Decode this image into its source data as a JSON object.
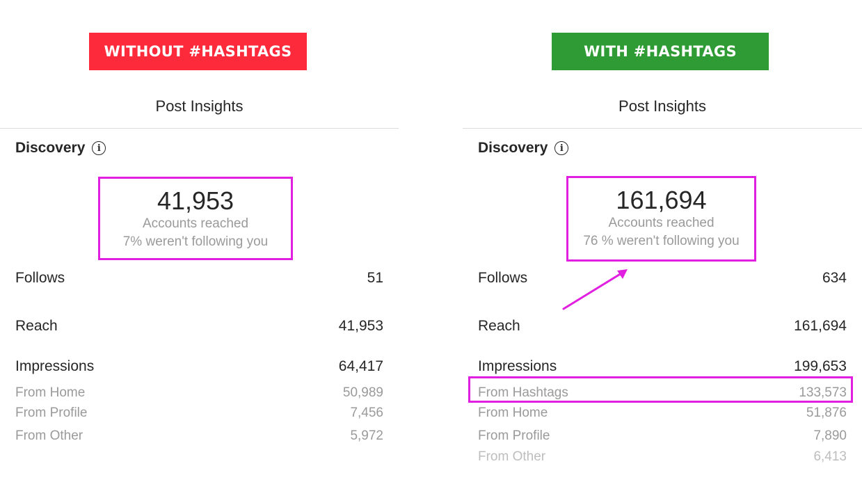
{
  "colors": {
    "without_banner": "#fc2a3b",
    "with_banner": "#2f9b35",
    "highlight": "#e11fe0"
  },
  "without": {
    "banner": "WITHOUT #HASHTAGS",
    "title": "Post Insights",
    "section": "Discovery",
    "accounts_reached_value": "41,953",
    "accounts_reached_label": "Accounts reached",
    "not_following": "7% weren't following you",
    "metrics": [
      {
        "label": "Follows",
        "value": "51"
      },
      {
        "label": "Reach",
        "value": "41,953"
      },
      {
        "label": "Impressions",
        "value": "64,417"
      }
    ],
    "impression_sources": [
      {
        "label": "From Home",
        "value": "50,989"
      },
      {
        "label": "From Profile",
        "value": "7,456"
      },
      {
        "label": "From Other",
        "value": "5,972"
      }
    ]
  },
  "with": {
    "banner": "WITH #HASHTAGS",
    "title": "Post Insights",
    "section": "Discovery",
    "accounts_reached_value": "161,694",
    "accounts_reached_label": "Accounts reached",
    "not_following": "76 % weren't following you",
    "metrics": [
      {
        "label": "Follows",
        "value": "634"
      },
      {
        "label": "Reach",
        "value": "161,694"
      },
      {
        "label": "Impressions",
        "value": "199,653"
      }
    ],
    "impression_sources": [
      {
        "label": "From Hashtags",
        "value": "133,573"
      },
      {
        "label": "From Home",
        "value": "51,876"
      },
      {
        "label": "From Profile",
        "value": "7,890"
      },
      {
        "label": "From Other",
        "value": "6,413"
      }
    ]
  },
  "icons": {
    "info": "i"
  }
}
